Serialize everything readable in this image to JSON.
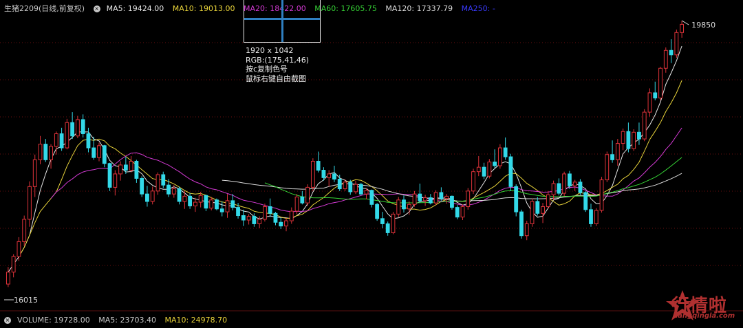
{
  "header": {
    "symbol": "生猪2209",
    "period": "(日线,前复权)",
    "ma5": "MA5: 19424.00",
    "ma10": "MA10: 19013.00",
    "ma20": "MA20: 18422.00",
    "ma60": "MA60: 17605.75",
    "ma120": "MA120: 17337.79",
    "ma250": "MA250: -"
  },
  "volume_bar": {
    "label": "VOLUME: 19728.00",
    "ma5": "MA5: 23703.40",
    "ma10": "MA10: 24978.70"
  },
  "screenshot_tool": {
    "size": "1920 x 1042",
    "rgb": "RGB:(175,41,46)",
    "copy_hint": "按c复制色号",
    "capture_hint": "鼠标右键自由截图"
  },
  "markers": {
    "high": "19850",
    "low": "16015"
  },
  "watermark": {
    "name": "行情啦",
    "url": "hangqingla.com"
  },
  "colors": {
    "up": "#e0333a",
    "down": "#33d9e8",
    "ma5": "#e8e8e8",
    "ma10": "#e8d33a",
    "ma20": "#d43ad4",
    "ma60": "#36d336",
    "ma120": "#dcdcdc",
    "ma250": "#3a3aff",
    "grid": "#6e0f0f"
  },
  "chart_data": {
    "type": "candlestick",
    "ylim": [
      16015,
      19850
    ],
    "grid": true,
    "ohlc": [
      [
        16310,
        16540,
        16270,
        16470
      ],
      [
        16470,
        16710,
        16400,
        16680
      ],
      [
        16680,
        16940,
        16620,
        16880
      ],
      [
        16880,
        17230,
        16820,
        17180
      ],
      [
        17180,
        17690,
        17080,
        17620
      ],
      [
        17620,
        18050,
        17480,
        17980
      ],
      [
        17980,
        18300,
        17920,
        18190
      ],
      [
        18190,
        18260,
        17950,
        17980
      ],
      [
        17980,
        18190,
        17860,
        18160
      ],
      [
        18160,
        18360,
        18050,
        18330
      ],
      [
        18330,
        18410,
        18100,
        18140
      ],
      [
        18140,
        18530,
        18120,
        18480
      ],
      [
        18480,
        18620,
        18260,
        18300
      ],
      [
        18300,
        18570,
        18270,
        18520
      ],
      [
        18520,
        18590,
        18280,
        18330
      ],
      [
        18330,
        18410,
        18080,
        18140
      ],
      [
        18140,
        18290,
        17980,
        18010
      ],
      [
        18010,
        18210,
        17960,
        18170
      ],
      [
        18170,
        18180,
        17880,
        17930
      ],
      [
        17930,
        17940,
        17560,
        17610
      ],
      [
        17610,
        17840,
        17500,
        17790
      ],
      [
        17790,
        17960,
        17700,
        17910
      ],
      [
        17910,
        18020,
        17790,
        17840
      ],
      [
        17840,
        18030,
        17810,
        17960
      ],
      [
        17960,
        17980,
        17670,
        17730
      ],
      [
        17730,
        17760,
        17480,
        17520
      ],
      [
        17520,
        17630,
        17350,
        17420
      ],
      [
        17420,
        17620,
        17380,
        17560
      ],
      [
        17560,
        17810,
        17510,
        17780
      ],
      [
        17780,
        17820,
        17600,
        17640
      ],
      [
        17640,
        17720,
        17480,
        17520
      ],
      [
        17520,
        17640,
        17470,
        17590
      ],
      [
        17590,
        17620,
        17380,
        17420
      ],
      [
        17420,
        17560,
        17320,
        17490
      ],
      [
        17490,
        17530,
        17320,
        17360
      ],
      [
        17360,
        17470,
        17280,
        17410
      ],
      [
        17410,
        17550,
        17340,
        17500
      ],
      [
        17500,
        17510,
        17290,
        17330
      ],
      [
        17330,
        17480,
        17300,
        17440
      ],
      [
        17440,
        17460,
        17300,
        17320
      ],
      [
        17320,
        17420,
        17220,
        17280
      ],
      [
        17280,
        17520,
        17200,
        17430
      ],
      [
        17430,
        17520,
        17300,
        17340
      ],
      [
        17340,
        17400,
        17190,
        17230
      ],
      [
        17230,
        17310,
        17090,
        17170
      ],
      [
        17170,
        17250,
        17110,
        17220
      ],
      [
        17220,
        17260,
        17080,
        17120
      ],
      [
        17120,
        17220,
        17060,
        17180
      ],
      [
        17180,
        17390,
        17150,
        17350
      ],
      [
        17350,
        17460,
        17210,
        17260
      ],
      [
        17260,
        17280,
        17100,
        17140
      ],
      [
        17140,
        17200,
        17050,
        17090
      ],
      [
        17090,
        17200,
        17020,
        17160
      ],
      [
        17160,
        17340,
        17120,
        17290
      ],
      [
        17290,
        17520,
        17250,
        17480
      ],
      [
        17480,
        17560,
        17380,
        17400
      ],
      [
        17400,
        17650,
        17360,
        17610
      ],
      [
        17610,
        18000,
        17560,
        17960
      ],
      [
        17960,
        18090,
        17810,
        17840
      ],
      [
        17840,
        17880,
        17700,
        17740
      ],
      [
        17740,
        17840,
        17620,
        17790
      ],
      [
        17790,
        17900,
        17680,
        17720
      ],
      [
        17720,
        17780,
        17560,
        17590
      ],
      [
        17590,
        17720,
        17560,
        17680
      ],
      [
        17680,
        17710,
        17510,
        17550
      ],
      [
        17550,
        17700,
        17520,
        17650
      ],
      [
        17650,
        17670,
        17500,
        17520
      ],
      [
        17520,
        17600,
        17450,
        17570
      ],
      [
        17570,
        17580,
        17340,
        17380
      ],
      [
        17380,
        17400,
        17160,
        17190
      ],
      [
        17190,
        17280,
        17060,
        17120
      ],
      [
        17120,
        17150,
        16960,
        17000
      ],
      [
        17000,
        17280,
        16980,
        17250
      ],
      [
        17250,
        17480,
        17210,
        17440
      ],
      [
        17440,
        17500,
        17270,
        17320
      ],
      [
        17320,
        17420,
        17240,
        17380
      ],
      [
        17380,
        17560,
        17350,
        17520
      ],
      [
        17520,
        17660,
        17400,
        17430
      ],
      [
        17430,
        17510,
        17360,
        17470
      ],
      [
        17470,
        17520,
        17380,
        17400
      ],
      [
        17400,
        17570,
        17370,
        17540
      ],
      [
        17540,
        17610,
        17430,
        17460
      ],
      [
        17460,
        17520,
        17390,
        17490
      ],
      [
        17490,
        17500,
        17310,
        17340
      ],
      [
        17340,
        17370,
        17180,
        17210
      ],
      [
        17210,
        17380,
        17170,
        17350
      ],
      [
        17350,
        17600,
        17310,
        17560
      ],
      [
        17560,
        17860,
        17520,
        17820
      ],
      [
        17820,
        18030,
        17760,
        17880
      ],
      [
        17880,
        17940,
        17720,
        17760
      ],
      [
        17760,
        17990,
        17730,
        17950
      ],
      [
        17950,
        18120,
        17870,
        17900
      ],
      [
        17900,
        18190,
        17860,
        18140
      ],
      [
        18140,
        18280,
        17980,
        18020
      ],
      [
        18020,
        18060,
        17560,
        17620
      ],
      [
        17620,
        17650,
        17220,
        17280
      ],
      [
        17280,
        17310,
        16920,
        16960
      ],
      [
        16960,
        17160,
        16900,
        17120
      ],
      [
        17120,
        17460,
        17080,
        17420
      ],
      [
        17420,
        17480,
        17230,
        17260
      ],
      [
        17260,
        17400,
        17130,
        17350
      ],
      [
        17350,
        17560,
        17320,
        17510
      ],
      [
        17510,
        17700,
        17440,
        17660
      ],
      [
        17660,
        17730,
        17500,
        17530
      ],
      [
        17530,
        17820,
        17490,
        17790
      ],
      [
        17790,
        17830,
        17590,
        17630
      ],
      [
        17630,
        17710,
        17560,
        17680
      ],
      [
        17680,
        17720,
        17510,
        17540
      ],
      [
        17540,
        17560,
        17280,
        17310
      ],
      [
        17310,
        17390,
        17080,
        17120
      ],
      [
        17120,
        17330,
        17090,
        17300
      ],
      [
        17300,
        17750,
        17270,
        17710
      ],
      [
        17710,
        18090,
        17680,
        18050
      ],
      [
        18050,
        18240,
        17940,
        17980
      ],
      [
        17980,
        18260,
        17900,
        18200
      ],
      [
        18200,
        18400,
        18110,
        18360
      ],
      [
        18360,
        18480,
        18080,
        18130
      ],
      [
        18130,
        18390,
        18100,
        18350
      ],
      [
        18350,
        18480,
        18180,
        18260
      ],
      [
        18260,
        18660,
        18230,
        18620
      ],
      [
        18620,
        18940,
        18560,
        18880
      ],
      [
        18880,
        19030,
        18780,
        18810
      ],
      [
        18810,
        19230,
        18780,
        19210
      ],
      [
        19210,
        19490,
        19150,
        19450
      ],
      [
        19450,
        19600,
        19280,
        19390
      ],
      [
        19390,
        19730,
        19350,
        19690
      ],
      [
        19690,
        19850,
        19620,
        19800
      ]
    ]
  }
}
